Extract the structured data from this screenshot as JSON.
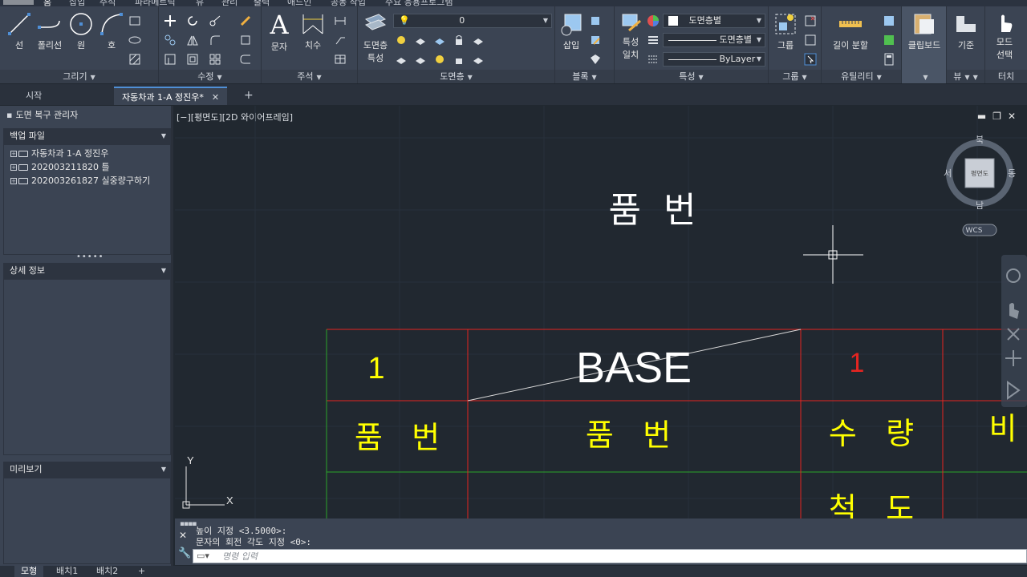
{
  "ribbon_tabs": [
    "홈",
    "삽입",
    "주석",
    "파라메트릭",
    "뷰",
    "관리",
    "출력",
    "애드인",
    "공동 작업",
    "주요 응용프로그램"
  ],
  "panels": {
    "draw": {
      "title": "그리기",
      "tools": [
        "선",
        "폴리선",
        "원",
        "호"
      ]
    },
    "modify": {
      "title": "수정"
    },
    "annotation": {
      "title": "주석",
      "tools": [
        "문자",
        "치수"
      ]
    },
    "layers": {
      "title": "도면층",
      "tool_line1": "도면층",
      "tool_line2": "특성",
      "layer_value": "0"
    },
    "block": {
      "title": "블록",
      "tool": "삽입"
    },
    "properties": {
      "title": "특성",
      "match_line1": "특성",
      "match_line2": "일치",
      "color": "도면층별",
      "linetype": "도면층별",
      "lineweight": "ByLayer"
    },
    "groups": {
      "title": "그룹",
      "tool": "그룹"
    },
    "utilities": {
      "title": "유틸리티",
      "tool": "길이 분할"
    },
    "clipboard": {
      "title": "",
      "tool": "클립보드"
    },
    "view": {
      "title": "뷰",
      "tool": "기준"
    },
    "touch": {
      "title": "터치",
      "tool_line1": "모드",
      "tool_line2": "선택"
    }
  },
  "file_tabs": {
    "start": "시작",
    "current": "자동차과 1-A 정진우*",
    "plus": "+"
  },
  "palette": {
    "title": "도면 복구 관리자",
    "backup_section": "백업 파일",
    "backup_files": [
      "자동차과 1-A 정진우",
      "202003211820 틀",
      "202003261827 실중량구하기"
    ],
    "details_section": "상세 정보",
    "preview_section": "미리보기"
  },
  "viewport": {
    "label": "[−][평면도][2D 와이어프레임]",
    "viewcube": {
      "north": "북",
      "south": "남",
      "east": "동",
      "west": "서",
      "face": "평면도",
      "wcs": "WCS"
    },
    "ucs": {
      "x": "X",
      "y": "Y"
    }
  },
  "drawing": {
    "title_text": "품  번",
    "row1": {
      "num_left": "1",
      "base": "BASE",
      "num_right": "1"
    },
    "row2": {
      "c1": "품   번",
      "c2": "품   번",
      "c3": "수   량",
      "c4": "비"
    },
    "row3": {
      "c3": "척   도"
    }
  },
  "command": {
    "history": [
      "높이 지정 <3.5000>:",
      "문자의 회전 각도 지정 <0>:"
    ],
    "placeholder": "명령 입력"
  },
  "layout_tabs": [
    "모형",
    "배치1",
    "배치2",
    "+"
  ],
  "colors": {
    "drawing_red": "#e52521",
    "drawing_green": "#2aa52a",
    "drawing_yellow": "#ffff00",
    "accent": "#4f8fd6"
  }
}
